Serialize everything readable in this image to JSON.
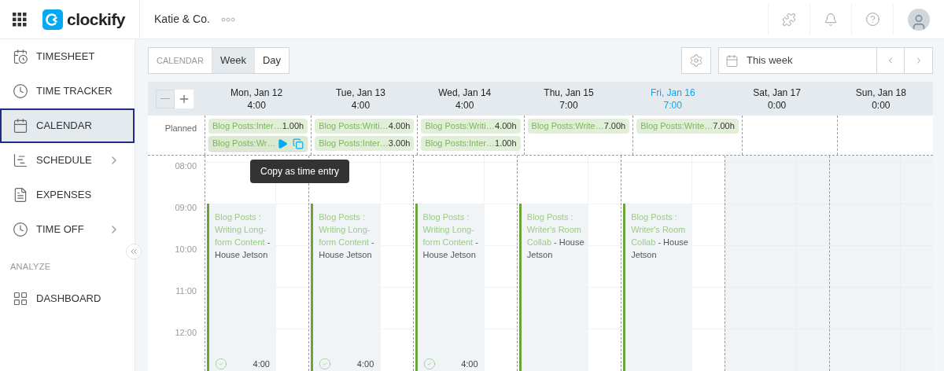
{
  "header": {
    "logo_text": "clockify",
    "workspace": "Katie & Co."
  },
  "sidebar": {
    "items": [
      {
        "label": "TIMESHEET",
        "kind": "timesheet",
        "selected": false,
        "submenu": false
      },
      {
        "label": "TIME TRACKER",
        "kind": "tracker",
        "selected": false,
        "submenu": false
      },
      {
        "label": "CALENDAR",
        "kind": "calendar",
        "selected": true,
        "submenu": false
      },
      {
        "label": "SCHEDULE",
        "kind": "schedule",
        "selected": false,
        "submenu": true
      },
      {
        "label": "EXPENSES",
        "kind": "expenses",
        "selected": false,
        "submenu": false
      },
      {
        "label": "TIME OFF",
        "kind": "timeoff",
        "selected": false,
        "submenu": true
      }
    ],
    "section": "ANALYZE",
    "analyze_items": [
      {
        "label": "DASHBOARD",
        "kind": "dashboard",
        "selected": false,
        "submenu": false
      }
    ]
  },
  "toolbar": {
    "view_label": "CALENDAR",
    "views": [
      {
        "label": "Week",
        "selected": true
      },
      {
        "label": "Day",
        "selected": false
      }
    ],
    "date_range": "This week"
  },
  "calendar": {
    "planned_label": "Planned",
    "tooltip": "Copy as time entry",
    "hours": [
      "08:00",
      "09:00",
      "10:00",
      "11:00",
      "12:00"
    ],
    "days": [
      {
        "date": "Mon, Jan 12",
        "total": "4:00",
        "today": false,
        "weekend": false,
        "planned": [
          {
            "label": "Blog Posts:Inter…",
            "hours": "1.00h",
            "hovered": false
          },
          {
            "label": "Blog Posts:Wr…",
            "hovered": true
          }
        ],
        "event": {
          "project": "Blog Posts : Writing Long-form Content",
          "client": "- House Jetson",
          "duration": "4:00"
        }
      },
      {
        "date": "Tue, Jan 13",
        "total": "4:00",
        "today": false,
        "weekend": false,
        "planned": [
          {
            "label": "Blog Posts:Writi…",
            "hours": "4.00h",
            "hovered": false
          },
          {
            "label": "Blog Posts:Inter…",
            "hours": "3.00h",
            "hovered": false
          }
        ],
        "event": {
          "project": "Blog Posts : Writing Long-form Content",
          "client": "- House Jetson",
          "duration": "4:00"
        }
      },
      {
        "date": "Wed, Jan 14",
        "total": "4:00",
        "today": false,
        "weekend": false,
        "planned": [
          {
            "label": "Blog Posts:Writi…",
            "hours": "4.00h",
            "hovered": false
          },
          {
            "label": "Blog Posts:Inter…",
            "hours": "1.00h",
            "hovered": false
          }
        ],
        "event": {
          "project": "Blog Posts : Writing Long-form Content",
          "client": "- House Jetson",
          "duration": "4:00"
        }
      },
      {
        "date": "Thu, Jan 15",
        "total": "7:00",
        "today": false,
        "weekend": false,
        "planned": [
          {
            "label": "Blog Posts:Write…",
            "hours": "7.00h",
            "hovered": false
          }
        ],
        "event": {
          "project": "Blog Posts : Writer's Room Collab",
          "client": "- House Jetson"
        }
      },
      {
        "date": "Fri, Jan 16",
        "total": "7:00",
        "today": true,
        "weekend": false,
        "planned": [
          {
            "label": "Blog Posts:Write…",
            "hours": "7.00h",
            "hovered": false
          }
        ],
        "event": {
          "project": "Blog Posts : Writer's Room Collab",
          "client": "- House Jetson"
        }
      },
      {
        "date": "Sat, Jan 17",
        "total": "0:00",
        "today": false,
        "weekend": true
      },
      {
        "date": "Sun, Jan 18",
        "total": "0:00",
        "today": false,
        "weekend": true
      }
    ]
  }
}
